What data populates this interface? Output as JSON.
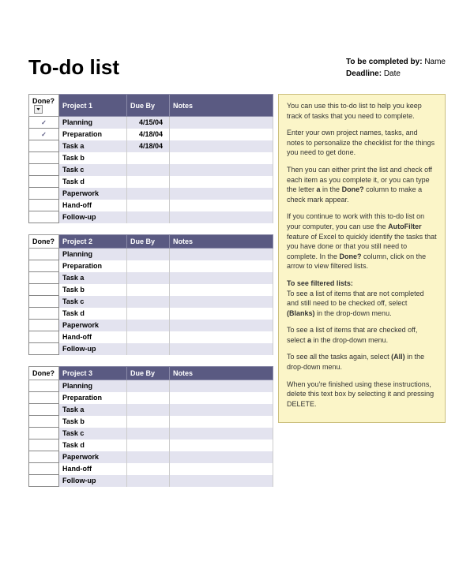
{
  "title": "To-do list",
  "meta": {
    "completed_by_label": "To be completed by:",
    "completed_by_value": "Name",
    "deadline_label": "Deadline:",
    "deadline_value": "Date"
  },
  "columns": {
    "done": "Done?",
    "due": "Due By",
    "notes": "Notes"
  },
  "projects": [
    {
      "name": "Project 1",
      "has_filter": true,
      "rows": [
        {
          "done": "✓",
          "task": "Planning",
          "due": "4/15/04",
          "notes": ""
        },
        {
          "done": "✓",
          "task": "Preparation",
          "due": "4/18/04",
          "notes": ""
        },
        {
          "done": "",
          "task": "Task a",
          "due": "4/18/04",
          "notes": ""
        },
        {
          "done": "",
          "task": "Task b",
          "due": "",
          "notes": ""
        },
        {
          "done": "",
          "task": "Task c",
          "due": "",
          "notes": ""
        },
        {
          "done": "",
          "task": "Task d",
          "due": "",
          "notes": ""
        },
        {
          "done": "",
          "task": "Paperwork",
          "due": "",
          "notes": ""
        },
        {
          "done": "",
          "task": "Hand-off",
          "due": "",
          "notes": ""
        },
        {
          "done": "",
          "task": "Follow-up",
          "due": "",
          "notes": ""
        }
      ]
    },
    {
      "name": "Project 2",
      "has_filter": false,
      "rows": [
        {
          "done": "",
          "task": "Planning",
          "due": "",
          "notes": ""
        },
        {
          "done": "",
          "task": "Preparation",
          "due": "",
          "notes": ""
        },
        {
          "done": "",
          "task": "Task a",
          "due": "",
          "notes": ""
        },
        {
          "done": "",
          "task": "Task b",
          "due": "",
          "notes": ""
        },
        {
          "done": "",
          "task": "Task c",
          "due": "",
          "notes": ""
        },
        {
          "done": "",
          "task": "Task d",
          "due": "",
          "notes": ""
        },
        {
          "done": "",
          "task": "Paperwork",
          "due": "",
          "notes": ""
        },
        {
          "done": "",
          "task": "Hand-off",
          "due": "",
          "notes": ""
        },
        {
          "done": "",
          "task": "Follow-up",
          "due": "",
          "notes": ""
        }
      ]
    },
    {
      "name": "Project 3",
      "has_filter": false,
      "rows": [
        {
          "done": "",
          "task": "Planning",
          "due": "",
          "notes": ""
        },
        {
          "done": "",
          "task": "Preparation",
          "due": "",
          "notes": ""
        },
        {
          "done": "",
          "task": "Task a",
          "due": "",
          "notes": ""
        },
        {
          "done": "",
          "task": "Task b",
          "due": "",
          "notes": ""
        },
        {
          "done": "",
          "task": "Task c",
          "due": "",
          "notes": ""
        },
        {
          "done": "",
          "task": "Task d",
          "due": "",
          "notes": ""
        },
        {
          "done": "",
          "task": "Paperwork",
          "due": "",
          "notes": ""
        },
        {
          "done": "",
          "task": "Hand-off",
          "due": "",
          "notes": ""
        },
        {
          "done": "",
          "task": "Follow-up",
          "due": "",
          "notes": ""
        }
      ]
    }
  ],
  "help": {
    "p1": "You can use this to-do list to help you keep track of tasks that you need to complete.",
    "p2": "Enter your own project names, tasks, and notes to personalize the checklist for the things you need to get done.",
    "p3a": "Then you can either print the list and check off each item as you complete it, or you can type the letter ",
    "p3b": "a",
    "p3c": " in the ",
    "p3d": "Done?",
    "p3e": " column to make a check mark appear.",
    "p4a": "If you continue to work with this to-do list on your computer, you can use the ",
    "p4b": "AutoFilter",
    "p4c": " feature of Excel to quickly identify the tasks that you have done or that you still need to complete. In the ",
    "p4d": "Done?",
    "p4e": " column, click on the arrow to view filtered lists.",
    "p5a": "To see filtered lists:",
    "p5b": "To see a list of items that are not completed and still need to be checked off, select ",
    "p5c": "(Blanks)",
    "p5d": " in the drop-down menu.",
    "p6a": "To see a list of items that are checked off, select ",
    "p6b": "a",
    "p6c": " in the drop-down menu.",
    "p7a": "To see all the tasks again, select ",
    "p7b": "(All)",
    "p7c": " in the drop-down menu.",
    "p8": "When you're finished using these instructions, delete this text box by selecting it and pressing DELETE."
  }
}
